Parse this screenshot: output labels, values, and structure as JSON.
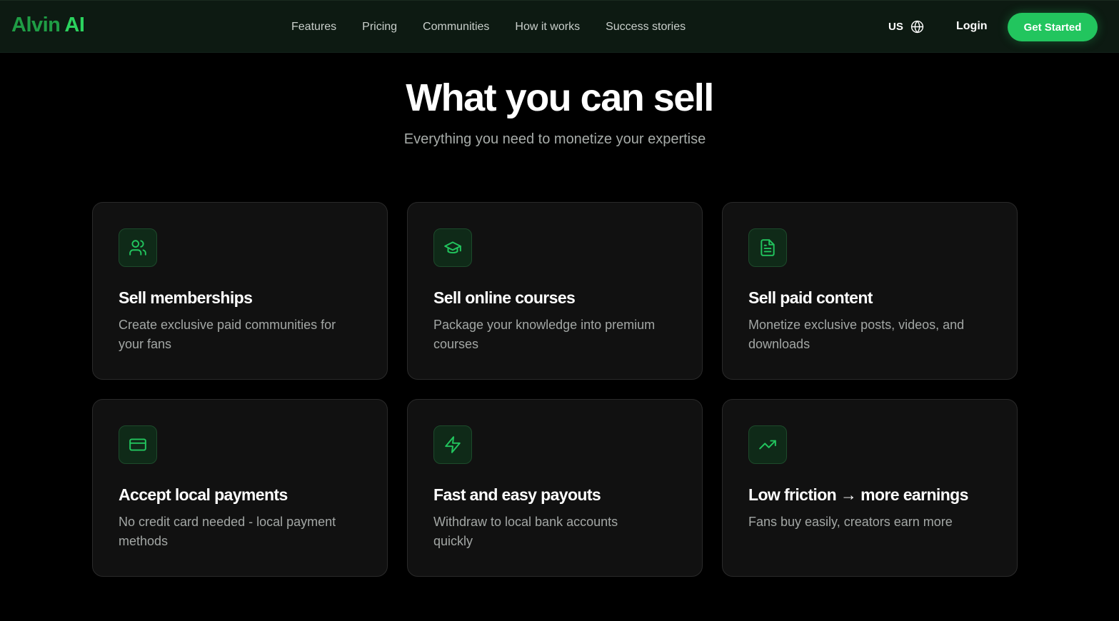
{
  "nav": {
    "logo_prefix": "Alvin",
    "logo_suffix": "AI",
    "links": [
      "Features",
      "Pricing",
      "Communities",
      "How it works",
      "Success stories"
    ],
    "locale": "US",
    "locale_icon": "globe-icon",
    "login": "Login",
    "cta": "Get Started"
  },
  "section": {
    "title": "What you can sell",
    "subtitle": "Everything you need to monetize your expertise"
  },
  "cards": [
    {
      "icon": "users-icon",
      "title": "Sell memberships",
      "description": "Create exclusive paid communities for your fans"
    },
    {
      "icon": "graduation-cap-icon",
      "title": "Sell online courses",
      "description": "Package your knowledge into premium courses"
    },
    {
      "icon": "file-text-icon",
      "title": "Sell paid content",
      "description": "Monetize exclusive posts, videos, and downloads"
    },
    {
      "icon": "credit-card-icon",
      "title": "Accept local payments",
      "description": "No credit card needed - local payment methods"
    },
    {
      "icon": "lightning-icon",
      "title": "Fast and easy payouts",
      "description": "Withdraw to local bank accounts quickly"
    },
    {
      "icon": "trending-up-icon",
      "title": "Low friction → more earnings",
      "description": "Fans buy easily, creators earn more"
    }
  ],
  "colors": {
    "accent": "#22c55e",
    "logo": "#1f9d45",
    "nav_background": "#0d1a12",
    "card_background": "#111111",
    "page_background": "#000000"
  }
}
